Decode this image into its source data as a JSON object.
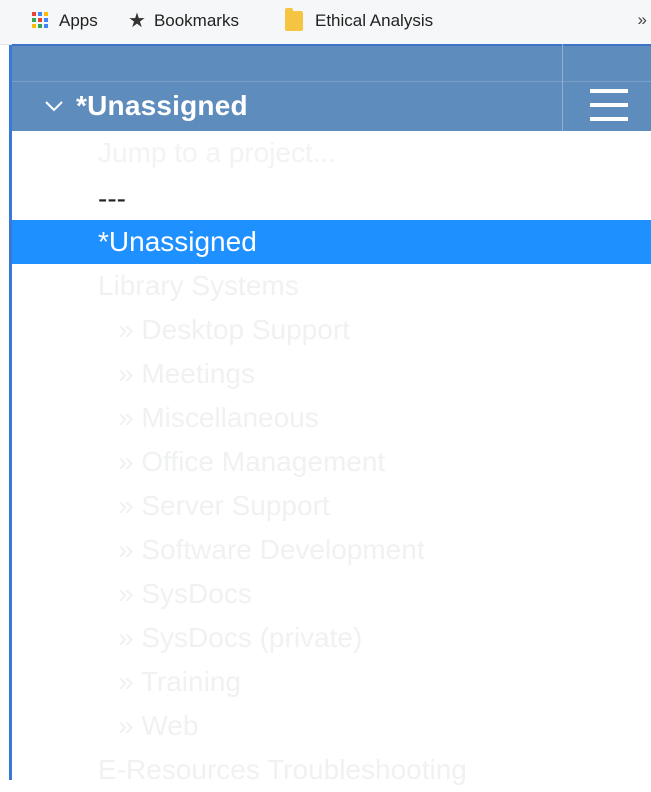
{
  "bookmarks_bar": {
    "items": [
      {
        "label": "Apps",
        "icon": "apps-grid-icon"
      },
      {
        "label": "Bookmarks",
        "icon": "star-icon"
      },
      {
        "label": "Ethical Analysis",
        "icon": "folder-icon"
      }
    ],
    "overflow": "»"
  },
  "header": {
    "selected_project": "*Unassigned",
    "expand_icon": "chevron-down-icon",
    "menu_icon": "hamburger-menu-icon",
    "background_color": "#5e8cbd"
  },
  "dropdown": {
    "placeholder": "Jump to a project...",
    "separator": "---",
    "selected_color": "#1e90ff",
    "options": [
      {
        "label": "*Unassigned",
        "selected": true,
        "level": 0
      },
      {
        "label": "Library Systems",
        "level": 0
      },
      {
        "label": "» Desktop Support",
        "level": 1
      },
      {
        "label": "» Meetings",
        "level": 1
      },
      {
        "label": "» Miscellaneous",
        "level": 1
      },
      {
        "label": "» Office Management",
        "level": 1
      },
      {
        "label": "» Server Support",
        "level": 1
      },
      {
        "label": "» Software Development",
        "level": 1
      },
      {
        "label": "» SysDocs",
        "level": 1
      },
      {
        "label": "» SysDocs (private)",
        "level": 1
      },
      {
        "label": "» Training",
        "level": 1
      },
      {
        "label": "» Web",
        "level": 1
      },
      {
        "label": "E-Resources Troubleshooting",
        "level": 0
      }
    ]
  }
}
